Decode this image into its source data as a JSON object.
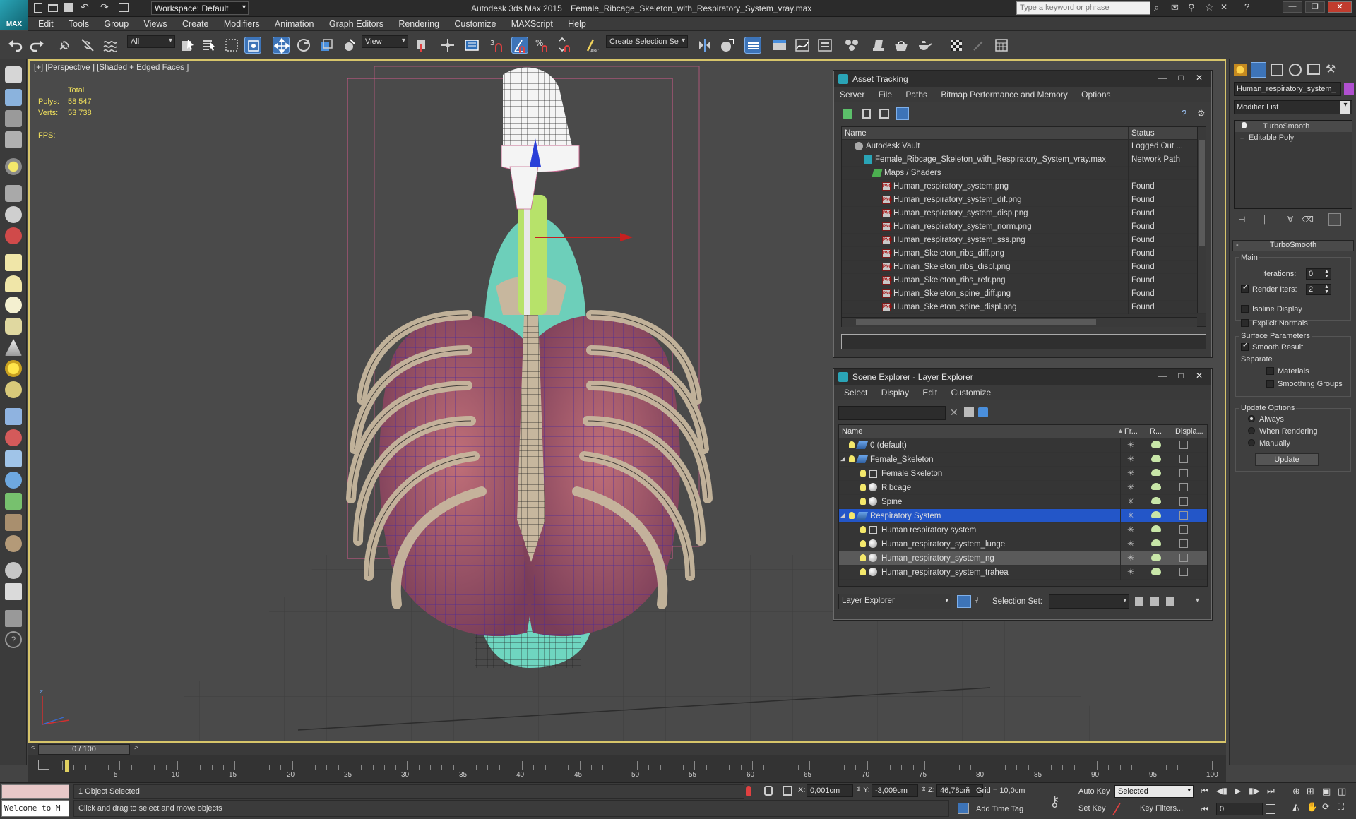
{
  "app": {
    "title": "Autodesk 3ds Max 2015",
    "file": "Female_Ribcage_Skeleton_with_Respiratory_System_vray.max",
    "logo": "MAX",
    "workspace": "Workspace: Default",
    "search_placeholder": "Type a keyword or phrase"
  },
  "menu": [
    "Edit",
    "Tools",
    "Group",
    "Views",
    "Create",
    "Modifiers",
    "Animation",
    "Graph Editors",
    "Rendering",
    "Customize",
    "MAXScript",
    "Help"
  ],
  "toolbar": {
    "filter": "All",
    "refcoord": "View",
    "selection_set": "Create Selection Se"
  },
  "viewport": {
    "label": "[+] [Perspective ] [Shaded + Edged Faces ]",
    "stats": {
      "total": "Total",
      "polys_label": "Polys:",
      "polys": "58 547",
      "verts_label": "Verts:",
      "verts": "53 738",
      "fps_label": "FPS:"
    }
  },
  "asset_tracking": {
    "title": "Asset Tracking",
    "menu": [
      "Server",
      "File",
      "Paths",
      "Bitmap Performance and Memory",
      "Options"
    ],
    "col_name": "Name",
    "col_status": "Status",
    "rows": [
      {
        "name": "Autodesk Vault",
        "status": "Logged Out ...",
        "level": 0,
        "kind": "vault"
      },
      {
        "name": "Female_Ribcage_Skeleton_with_Respiratory_System_vray.max",
        "status": "Network Path",
        "level": 1,
        "kind": "max"
      },
      {
        "name": "Maps / Shaders",
        "status": "",
        "level": 2,
        "kind": "maps"
      },
      {
        "name": "Human_respiratory_system.png",
        "status": "Found",
        "level": 3,
        "kind": "png"
      },
      {
        "name": "Human_respiratory_system_dif.png",
        "status": "Found",
        "level": 3,
        "kind": "png"
      },
      {
        "name": "Human_respiratory_system_disp.png",
        "status": "Found",
        "level": 3,
        "kind": "png"
      },
      {
        "name": "Human_respiratory_system_norm.png",
        "status": "Found",
        "level": 3,
        "kind": "png"
      },
      {
        "name": "Human_respiratory_system_sss.png",
        "status": "Found",
        "level": 3,
        "kind": "png"
      },
      {
        "name": "Human_Skeleton_ribs_diff.png",
        "status": "Found",
        "level": 3,
        "kind": "png"
      },
      {
        "name": "Human_Skeleton_ribs_displ.png",
        "status": "Found",
        "level": 3,
        "kind": "png"
      },
      {
        "name": "Human_Skeleton_ribs_refr.png",
        "status": "Found",
        "level": 3,
        "kind": "png"
      },
      {
        "name": "Human_Skeleton_spine_diff.png",
        "status": "Found",
        "level": 3,
        "kind": "png"
      },
      {
        "name": "Human_Skeleton_spine_displ.png",
        "status": "Found",
        "level": 3,
        "kind": "png"
      }
    ]
  },
  "scene_explorer": {
    "title": "Scene Explorer - Layer Explorer",
    "menu": [
      "Select",
      "Display",
      "Edit",
      "Customize"
    ],
    "col_name": "Name",
    "col_fr": "Fr...",
    "col_r": "R...",
    "col_disp": "Displa...",
    "rows": [
      {
        "name": "0 (default)",
        "level": 0,
        "kind": "layer",
        "state": ""
      },
      {
        "name": "Female_Skeleton",
        "level": 0,
        "kind": "layer",
        "state": "expanded"
      },
      {
        "name": "Female Skeleton",
        "level": 1,
        "kind": "group",
        "state": ""
      },
      {
        "name": "Ribcage",
        "level": 1,
        "kind": "object",
        "state": ""
      },
      {
        "name": "Spine",
        "level": 1,
        "kind": "object",
        "state": ""
      },
      {
        "name": "Respiratory System",
        "level": 0,
        "kind": "layer",
        "state": "selected"
      },
      {
        "name": "Human respiratory system",
        "level": 1,
        "kind": "group",
        "state": ""
      },
      {
        "name": "Human_respiratory_system_lunge",
        "level": 1,
        "kind": "object",
        "state": ""
      },
      {
        "name": "Human_respiratory_system_ng",
        "level": 1,
        "kind": "object",
        "state": "highlighted"
      },
      {
        "name": "Human_respiratory_system_trahea",
        "level": 1,
        "kind": "object",
        "state": ""
      }
    ],
    "footer_mode": "Layer Explorer",
    "selection_set_label": "Selection Set:"
  },
  "command_panel": {
    "object_name": "Human_respiratory_system_",
    "modifier_list": "Modifier List",
    "stack": [
      "TurboSmooth",
      "Editable Poly"
    ],
    "rollout_title": "TurboSmooth",
    "main": "Main",
    "iterations_label": "Iterations:",
    "iterations": "0",
    "render_iters_label": "Render Iters:",
    "render_iters": "2",
    "isoline": "Isoline Display",
    "explicit": "Explicit Normals",
    "surface_params": "Surface Parameters",
    "smooth_result": "Smooth Result",
    "separate": "Separate",
    "materials": "Materials",
    "smoothing_groups": "Smoothing Groups",
    "update_options": "Update Options",
    "always": "Always",
    "when_rendering": "When Rendering",
    "manually": "Manually",
    "update_btn": "Update"
  },
  "timeline": {
    "frame": "0 / 100",
    "ticks": [
      "5",
      "10",
      "15",
      "20",
      "25",
      "30",
      "35",
      "40",
      "45",
      "50",
      "55",
      "60",
      "65",
      "70",
      "75",
      "80",
      "85",
      "90",
      "95",
      "100"
    ]
  },
  "status": {
    "listener": "Welcome to M",
    "selected": "1 Object Selected",
    "prompt": "Click and drag to select and move objects",
    "x_label": "X:",
    "x": "0,001cm",
    "y_label": "Y:",
    "y": "-3,009cm",
    "z_label": "Z:",
    "z": "46,78cm",
    "grid": "Grid = 10,0cm",
    "add_time_tag": "Add Time Tag",
    "auto_key": "Auto Key",
    "set_key": "Set Key",
    "key_mode": "Selected",
    "key_filters": "Key Filters...",
    "current_frame": "0"
  }
}
